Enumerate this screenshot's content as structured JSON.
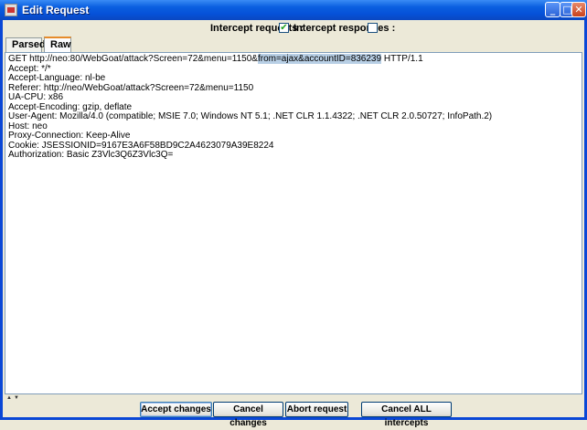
{
  "window": {
    "title": "Edit Request"
  },
  "intercept": {
    "requests_label": "Intercept requests :",
    "requests_checked": true,
    "responses_label": "Intercept responses :",
    "responses_checked": false
  },
  "tabs": [
    {
      "label": "Parsed",
      "active": false
    },
    {
      "label": "Raw",
      "active": true
    }
  ],
  "request": {
    "first_line_before": "GET http://neo:80/WebGoat/attack?Screen=72&menu=1150&",
    "first_line_selected": "from=ajax&accountID=836239",
    "first_line_after": " HTTP/1.1",
    "headers": [
      "Accept: */*",
      "Accept-Language: nl-be",
      "Referer: http://neo/WebGoat/attack?Screen=72&menu=1150",
      "UA-CPU: x86",
      "Accept-Encoding: gzip, deflate",
      "User-Agent: Mozilla/4.0 (compatible; MSIE 7.0; Windows NT 5.1; .NET CLR 1.1.4322; .NET CLR 2.0.50727; InfoPath.2)",
      "Host: neo",
      "Proxy-Connection: Keep-Alive",
      "Cookie: JSESSIONID=9167E3A6F58BD9C2A4623079A39E8224",
      "Authorization: Basic Z3Vlc3Q6Z3Vlc3Q="
    ]
  },
  "buttons": {
    "accept": "Accept changes",
    "cancel": "Cancel changes",
    "abort": "Abort request",
    "cancel_all": "Cancel ALL intercepts"
  },
  "icons": {
    "check_mark": "✔",
    "minimize": "_",
    "maximize": "□",
    "close": "✕",
    "split_up": "▲",
    "split_down": "▼"
  }
}
